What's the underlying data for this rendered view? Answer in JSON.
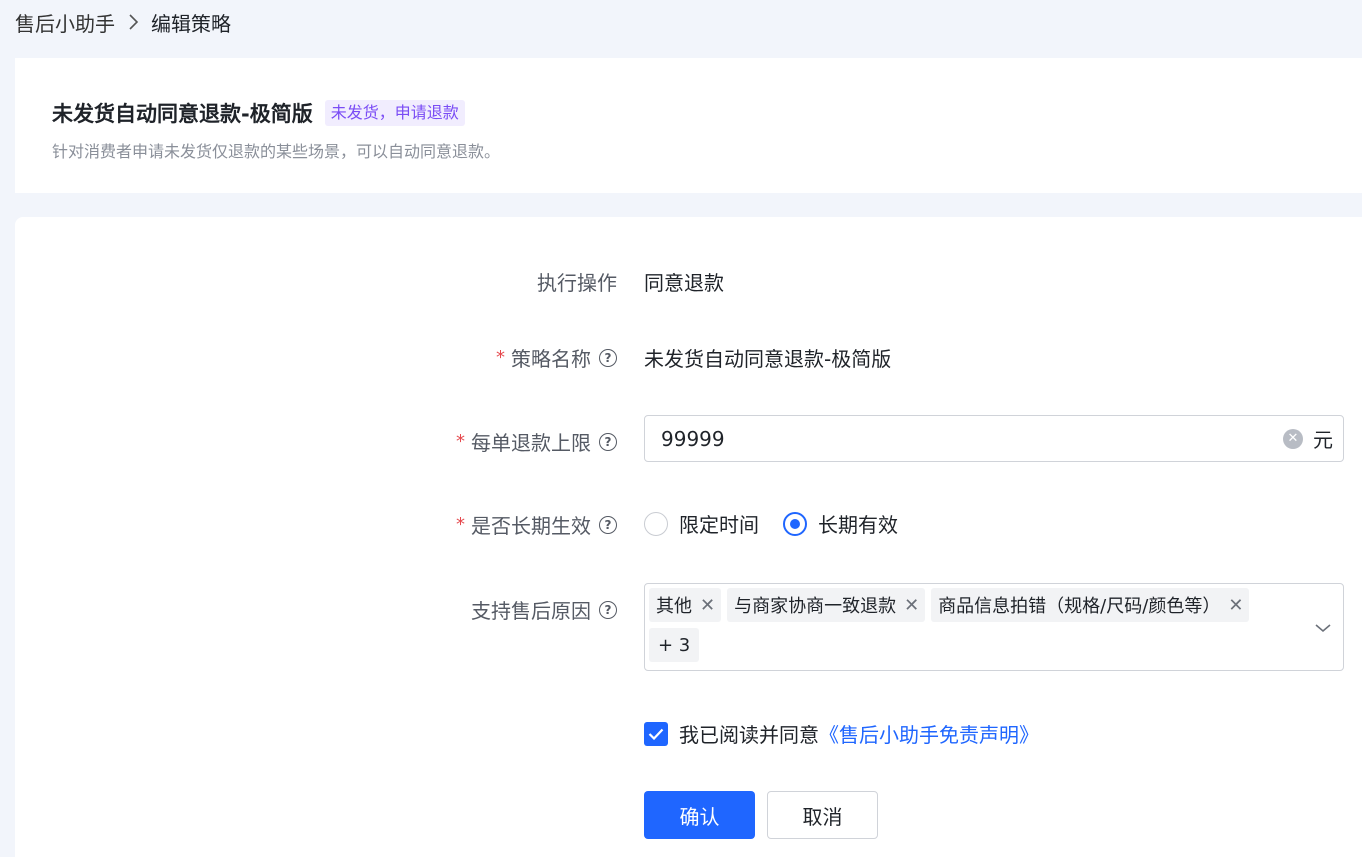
{
  "breadcrumb": {
    "parent": "售后小助手",
    "current": "编辑策略"
  },
  "header": {
    "title": "未发货自动同意退款-极简版",
    "tag": "未发货，申请退款",
    "subtitle": "针对消费者申请未发货仅退款的某些场景，可以自动同意退款。"
  },
  "form": {
    "action": {
      "label": "执行操作",
      "value": "同意退款"
    },
    "name": {
      "label": "策略名称",
      "value": "未发货自动同意退款-极简版",
      "required": true
    },
    "limit": {
      "label": "每单退款上限",
      "value": "99999",
      "suffix": "元",
      "required": true
    },
    "validity": {
      "label": "是否长期生效",
      "required": true,
      "options": [
        "限定时间",
        "长期有效"
      ],
      "selected": "长期有效"
    },
    "reasons": {
      "label": "支持售后原因",
      "tags": [
        "其他",
        "与商家协商一致退款",
        "商品信息拍错（规格/尺码/颜色等）"
      ],
      "more": "+ 3"
    },
    "agreement": {
      "text": "我已阅读并同意",
      "link": "《售后小助手免责声明》",
      "checked": true
    },
    "buttons": {
      "confirm": "确认",
      "cancel": "取消"
    }
  },
  "colors": {
    "primary": "#1f66ff",
    "required": "#e5484d",
    "tag_bg": "#f1edfe",
    "tag_text": "#7a4cf5"
  }
}
